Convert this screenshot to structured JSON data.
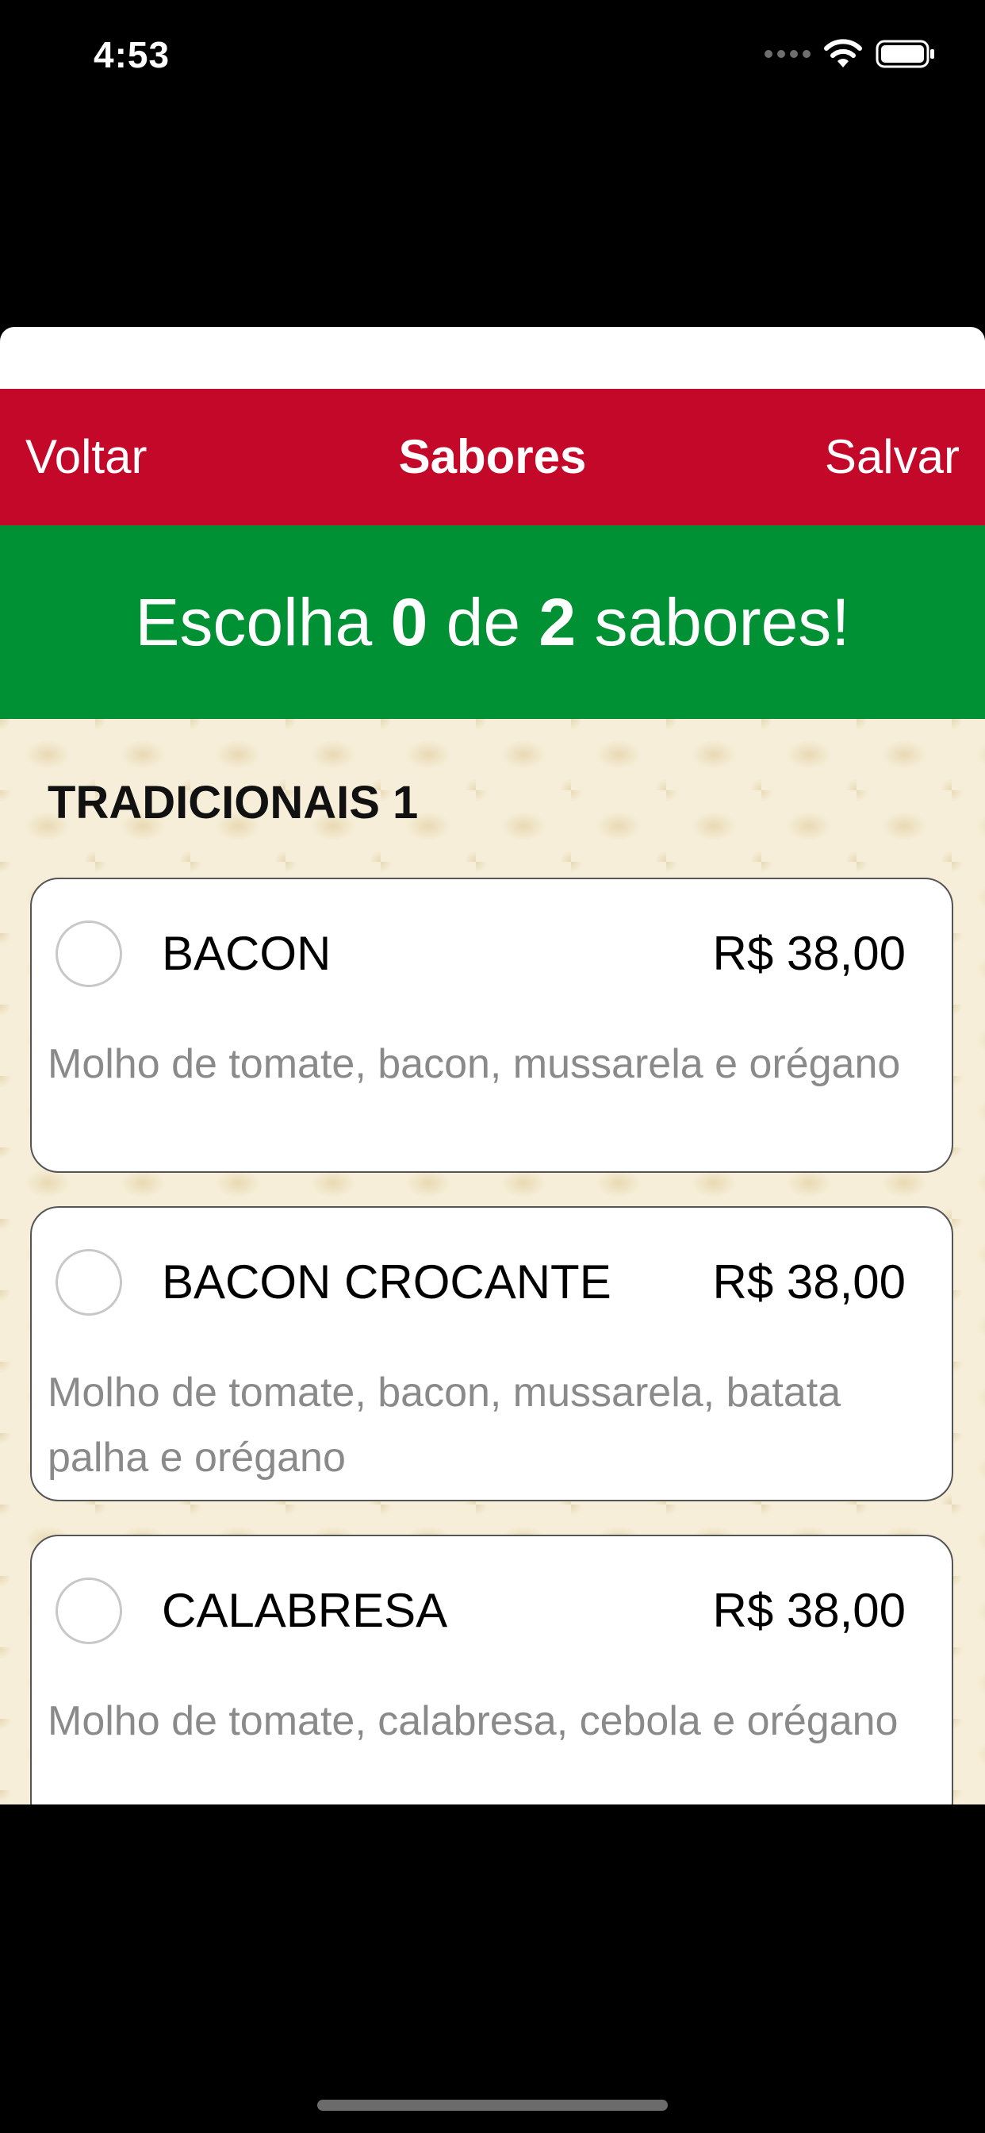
{
  "status_bar": {
    "time": "4:53",
    "icons": [
      "signal-icon",
      "wifi-icon",
      "battery-icon"
    ]
  },
  "navbar": {
    "back_label": "Voltar",
    "title": "Sabores",
    "save_label": "Salvar"
  },
  "banner": {
    "prefix": "Escolha ",
    "selected": "0",
    "middle": " de ",
    "max": "2",
    "suffix": " sabores!"
  },
  "section": {
    "title": "TRADICIONAIS 1"
  },
  "flavors": [
    {
      "name": "BACON",
      "price": "R$ 38,00",
      "description": "Molho de tomate, bacon, mussarela e orégano"
    },
    {
      "name": "BACON CROCANTE",
      "price": "R$ 38,00",
      "description": "Molho de tomate, bacon, mussarela, batata palha e orégano"
    },
    {
      "name": "CALABRESA",
      "price": "R$ 38,00",
      "description": "Molho de tomate, calabresa, cebola e orégano"
    }
  ],
  "colors": {
    "navbar": "#c4082a",
    "banner": "#009135",
    "background": "#f6eed8",
    "description_text": "#8a8a8a"
  }
}
